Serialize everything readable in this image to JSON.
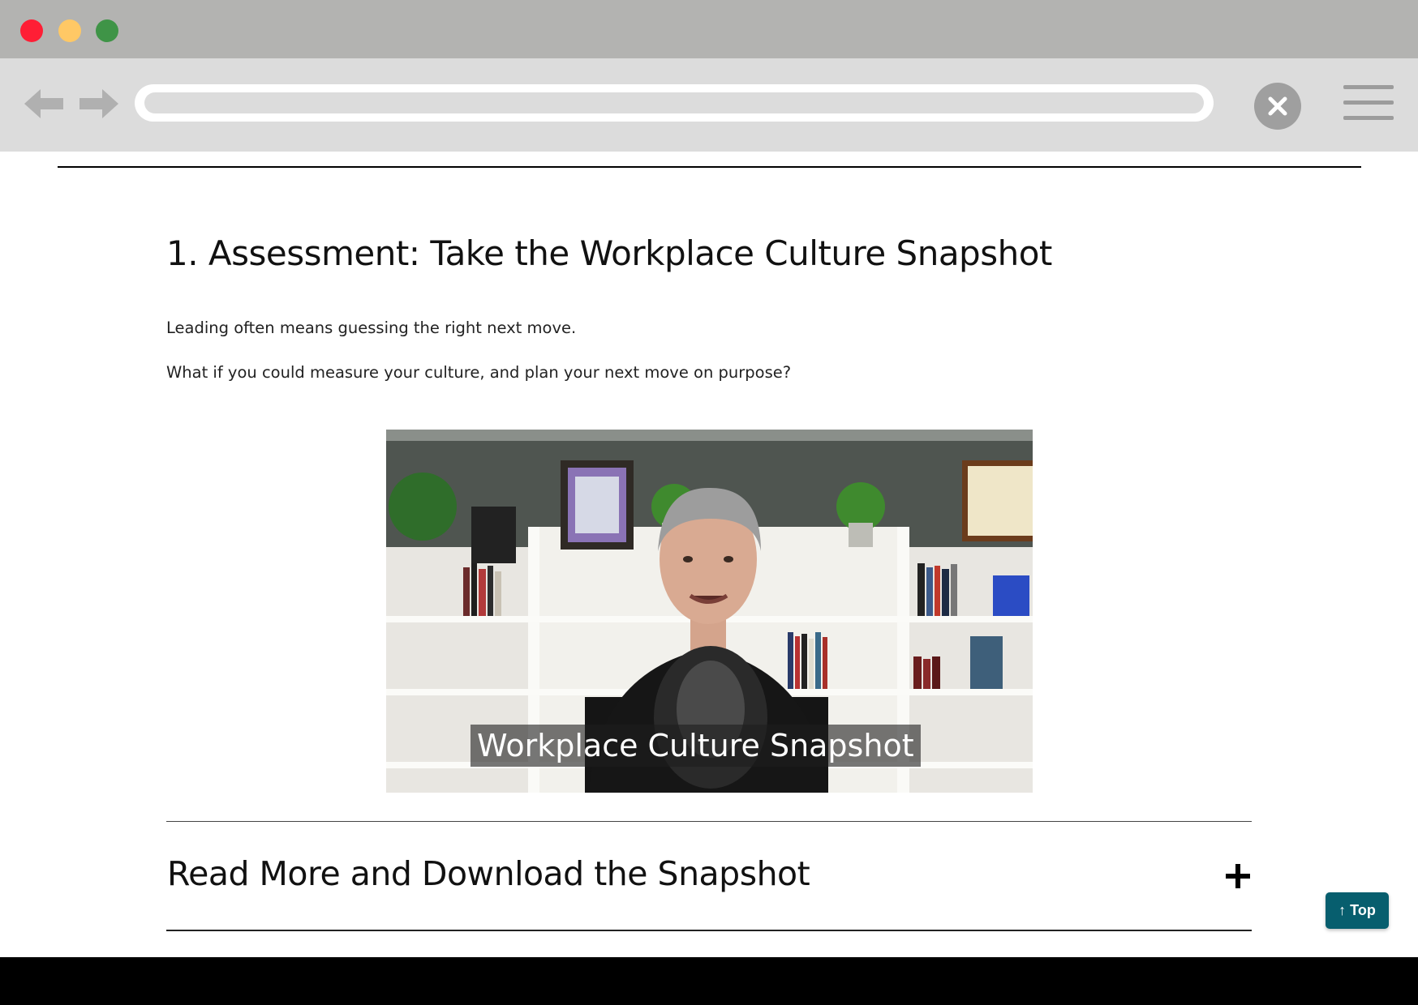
{
  "browser": {
    "address_value": ""
  },
  "section": {
    "heading": "1. Assessment: Take the Workplace Culture Snapshot",
    "paragraphs": [
      "Leading often means guessing the right next move.",
      "What if you could measure your culture, and plan your next move on purpose?"
    ]
  },
  "video": {
    "caption": "Workplace Culture Snapshot"
  },
  "accordion": {
    "title": "Read More and Download the Snapshot"
  },
  "back_to_top": {
    "label": "↑ Top"
  },
  "colors": {
    "accent": "#075e6e",
    "close_red": "#ff1e35",
    "minimize_yellow": "#ffc865",
    "maximize_green": "#3f9447"
  },
  "icons": [
    "back-arrow-icon",
    "forward-arrow-icon",
    "close-icon",
    "hamburger-menu-icon",
    "plus-icon"
  ]
}
